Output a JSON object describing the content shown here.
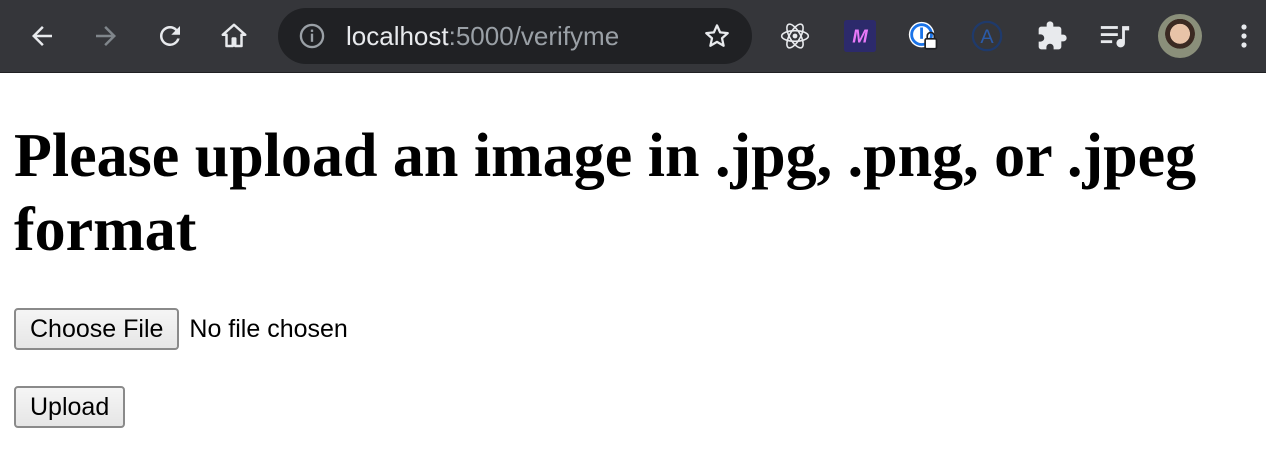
{
  "browser": {
    "url_host": "localhost",
    "url_rest": ":5000/verifyme",
    "extension_badge_text": "M",
    "extension_letter": "A",
    "icons": [
      "back-icon",
      "forward-icon",
      "reload-icon",
      "home-icon",
      "info-icon",
      "star-icon",
      "react-devtools-icon",
      "extension-m-icon",
      "extension-lock-icon",
      "extension-a-icon",
      "puzzle-icon",
      "media-icon",
      "avatar",
      "menu-icon"
    ]
  },
  "page": {
    "heading": "Please upload an image in .jpg, .png, or .jpeg format",
    "choose_file_label": "Choose File",
    "no_file_text": "No file chosen",
    "upload_label": "Upload"
  }
}
